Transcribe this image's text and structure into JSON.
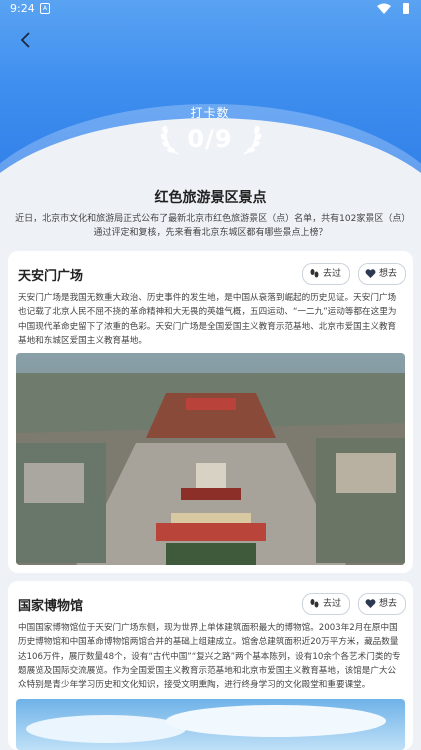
{
  "status_bar": {
    "time": "9:24",
    "notification_icon": "a-badge-icon"
  },
  "header": {
    "counter_label": "打卡数",
    "counter_value": "0/9"
  },
  "section": {
    "title": "红色旅游景区景点",
    "intro": "近日，北京市文化和旅游局正式公布了最新北京市红色旅游景区（点）名单，共有102家景区（点）通过评定和复核，先来看看北京东城区都有哪些景点上榜？"
  },
  "actions": {
    "go_label": "去过",
    "want_label": "想去"
  },
  "cards": [
    {
      "name": "天安门广场",
      "desc": "天安门广场是我国无数重大政治、历史事件的发生地，是中国从衰落到崛起的历史见证。天安门广场也记载了北京人民不屈不挠的革命精神和大无畏的英雄气概，五四运动、“一二九”运动等都在这里为中国现代革命史留下了浓重的色彩。天安门广场是全国爱国主义教育示范基地、北京市爱国主义教育基地和东城区爱国主义教育基地。"
    },
    {
      "name": "国家博物馆",
      "desc": "中国国家博物馆位于天安门广场东侧，现为世界上单体建筑面积最大的博物馆。2003年2月在原中国历史博物馆和中国革命博物馆两馆合并的基础上组建成立。馆舍总建筑面积近20万平方米，藏品数量达106万件，展厅数量48个，设有“古代中国”“复兴之路”两个基本陈列，设有10余个各艺术门类的专题展览及国际交流展览。作为全国爱国主义教育示范基地和北京市爱国主义教育基地，该馆是广大公众特别是青少年学习历史和文化知识，接受文明熏陶，进行终身学习的文化殿堂和重要课堂。"
    }
  ]
}
